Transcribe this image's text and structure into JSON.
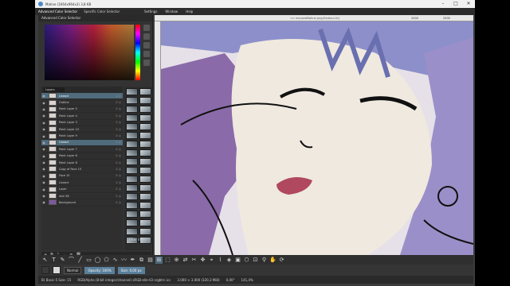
{
  "window": {
    "title": "Mahne (1664x964x3) 3,8 KB",
    "controls": [
      "–",
      "□",
      "✕"
    ]
  },
  "menu": {
    "tabs": [
      "Advanced Color Selector",
      "Specific Color Selector"
    ],
    "items": [
      "Settings",
      "Window",
      "Help"
    ]
  },
  "color_docker": {
    "title": "Advanced Color Selector"
  },
  "layers": {
    "header": "Layers",
    "rows": [
      {
        "name": "Lineart",
        "selected": true,
        "thumb": "light"
      },
      {
        "name": "Outline",
        "selected": false,
        "thumb": "light"
      },
      {
        "name": "Paint Layer 5",
        "selected": false,
        "thumb": "light"
      },
      {
        "name": "Paint Layer 4",
        "selected": false,
        "thumb": "light"
      },
      {
        "name": "Paint Layer 3",
        "selected": false,
        "thumb": "light"
      },
      {
        "name": "Paint Layer 10",
        "selected": false,
        "thumb": "light"
      },
      {
        "name": "Paint Layer 9",
        "selected": false,
        "thumb": "light"
      },
      {
        "name": "Lineart",
        "selected": true,
        "thumb": "light"
      },
      {
        "name": "Paint Layer 7",
        "selected": false,
        "thumb": "light"
      },
      {
        "name": "Paint Layer 6",
        "selected": false,
        "thumb": "light"
      },
      {
        "name": "Paint Layer 8",
        "selected": false,
        "thumb": "light"
      },
      {
        "name": "Copy of Face 15",
        "selected": false,
        "thumb": "light"
      },
      {
        "name": "Face 15",
        "selected": false,
        "thumb": "light"
      },
      {
        "name": "Lineart",
        "selected": false,
        "thumb": "light"
      },
      {
        "name": "Layer",
        "selected": false,
        "thumb": "light"
      },
      {
        "name": "skin 58",
        "selected": false,
        "thumb": "light"
      },
      {
        "name": "Background",
        "selected": false,
        "thumb": "purple"
      }
    ],
    "filter_label": "Filter in"
  },
  "canvas": {
    "title": "<< mousedMahne.png(Harbour-ht)",
    "ruler": [
      "",
      "",
      "",
      "",
      "",
      "",
      "",
      "",
      "2000",
      "2500"
    ]
  },
  "toolbar": {
    "tools": [
      "↖",
      "T",
      "✎",
      "⌒",
      "╱",
      "▭",
      "◯",
      "⬠",
      "∿",
      "〰",
      "✒",
      "⧉",
      "▤",
      "⊞",
      "⬚",
      "⊕",
      "⇄",
      "✂",
      "✥",
      "⌖",
      "⌇",
      "◈",
      "▣",
      "⬡",
      "⊡",
      "⚲",
      "✋",
      "⟳"
    ],
    "active_index": 13
  },
  "options": {
    "blend_mode": "Normal",
    "opacity_label": "Opacity: 100%",
    "size_label": "Size: 0,00 px",
    "colors": {
      "fg": "#3a3a3a",
      "bg": "#d9d9d9"
    }
  },
  "status": {
    "left": "B) Basic-5 Size: 15",
    "colorspace": "RGB/Alpha (8-bit integer/channel) sRGB-elle-V2-srgbtrc.icc",
    "dims": "3.000 × 3.000 (320,3 MiB)",
    "rotation": "0,00°",
    "zoom": "141,4%"
  },
  "colors": {
    "accent": "#4f6b7c",
    "canvas_purple": "#8a6aa8",
    "skin": "#efe9e0",
    "hair": "#8c8fc9",
    "lips": "#b04860"
  }
}
